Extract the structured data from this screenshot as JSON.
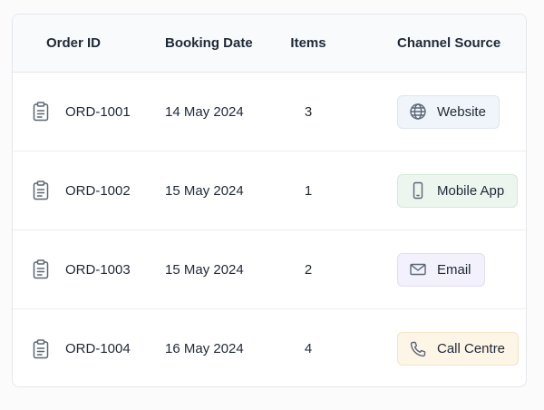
{
  "table": {
    "headers": {
      "order_id": "Order ID",
      "booking_date": "Booking Date",
      "items": "Items",
      "channel_source": "Channel Source"
    },
    "rows": [
      {
        "order_id": "ORD-1001",
        "booking_date": "14 May 2024",
        "items": "3",
        "channel": "Website",
        "channel_icon": "globe-icon",
        "badge_bg": "#f0f5fb",
        "badge_border": "#dbe6f3"
      },
      {
        "order_id": "ORD-1002",
        "booking_date": "15 May 2024",
        "items": "1",
        "channel": "Mobile App",
        "channel_icon": "smartphone-icon",
        "badge_bg": "#ecf6ee",
        "badge_border": "#d3e9d8"
      },
      {
        "order_id": "ORD-1003",
        "booking_date": "15 May 2024",
        "items": "2",
        "channel": "Email",
        "channel_icon": "mail-icon",
        "badge_bg": "#f3f1fb",
        "badge_border": "#e1ddf3"
      },
      {
        "order_id": "ORD-1004",
        "booking_date": "16 May 2024",
        "items": "4",
        "channel": "Call Centre",
        "channel_icon": "phone-icon",
        "badge_bg": "#fdf5e6",
        "badge_border": "#f3e4c4"
      }
    ]
  },
  "colors": {
    "icon_stroke": "#5b6675",
    "text": "#1f2937",
    "header_bg": "#f8fafc"
  }
}
